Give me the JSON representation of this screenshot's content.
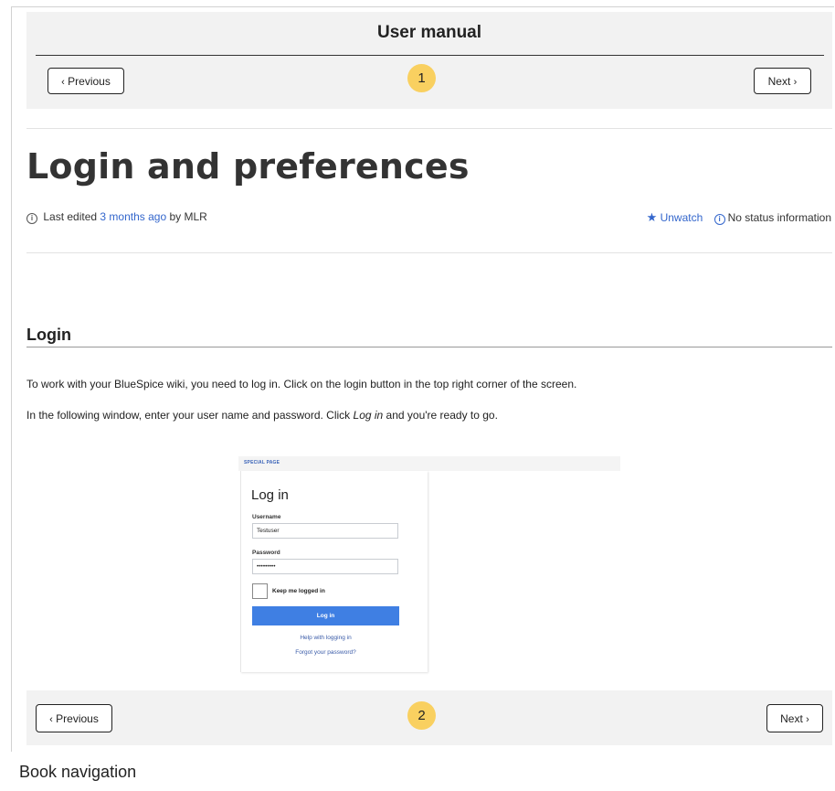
{
  "book": {
    "title": "User manual",
    "prev_label": "Previous",
    "next_label": "Next",
    "chev_left": "‹",
    "chev_right": "›",
    "badge_top": "1",
    "badge_bottom": "2"
  },
  "page": {
    "title": "Login and preferences",
    "meta": {
      "info_glyph": "i",
      "prefix": "Last edited",
      "time_link": "3 months ago",
      "by": "by",
      "author": "MLR",
      "star_glyph": "★",
      "watch_label": "Unwatch",
      "status_glyph": "i",
      "status_label": "No status information"
    }
  },
  "content": {
    "section_heading": "Login",
    "para1": "To work with your BlueSpice wiki, you need to log in. Click on the login button in the top right corner of the screen.",
    "para2_before": "In the following window, enter your user name and password. Click ",
    "para2_em": "Log in",
    "para2_after": " and you're ready to go."
  },
  "screenshot": {
    "bar_label": "SPECIAL PAGE",
    "title": "Log in",
    "username_label": "Username",
    "username_value": "Testuser",
    "password_label": "Password",
    "password_value": "•••••••••",
    "keep_logged_in": "Keep me logged in",
    "login_button": "Log in",
    "help_link": "Help with logging in",
    "forgot_link": "Forgot your password?"
  },
  "caption": "Book navigation",
  "colors": {
    "link": "#3366cc",
    "badge": "#f9d060",
    "nav_background": "#f2f2f2",
    "login_button": "#3f7fe3"
  }
}
